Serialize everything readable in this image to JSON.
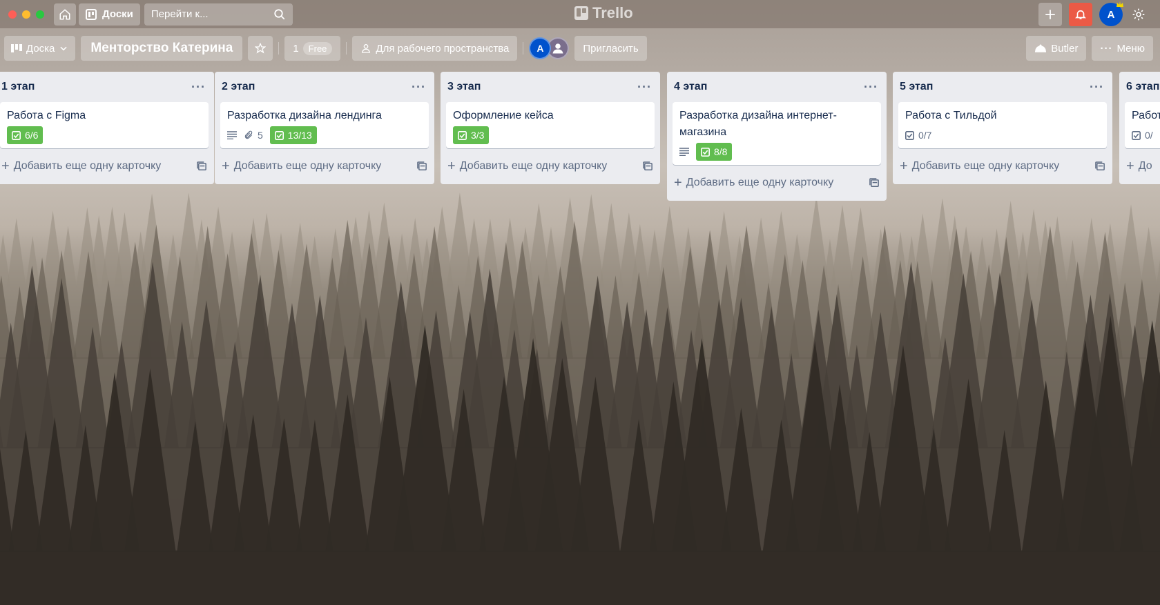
{
  "app": {
    "logo_text": "Trello",
    "boards_label": "Доски",
    "search_placeholder": "Перейти к..."
  },
  "account": {
    "avatar_initial": "A"
  },
  "board": {
    "view_label": "Доска",
    "title": "Менторство Катерина",
    "member_count": "1",
    "plan_label": "Free",
    "visibility_label": "Для рабочего пространства",
    "invite_label": "Пригласить",
    "butler_label": "Butler",
    "menu_label": "Меню",
    "members": [
      {
        "initial": "A",
        "color": "#0052cc"
      }
    ]
  },
  "lists": [
    {
      "title": "1 этап",
      "cards": [
        {
          "title": "Работа с Figma",
          "description": false,
          "attachments": "",
          "checklist": "6/6",
          "complete": true
        }
      ]
    },
    {
      "title": "2 этап",
      "cards": [
        {
          "title": "Разработка дизайна лендинга",
          "description": true,
          "attachments": "5",
          "checklist": "13/13",
          "complete": true
        }
      ]
    },
    {
      "title": "3 этап",
      "cards": [
        {
          "title": "Оформление кейса",
          "description": false,
          "attachments": "",
          "checklist": "3/3",
          "complete": true
        }
      ]
    },
    {
      "title": "4 этап",
      "cards": [
        {
          "title": "Разработка дизайна интернет-магазина",
          "description": true,
          "attachments": "",
          "checklist": "8/8",
          "complete": true
        }
      ]
    },
    {
      "title": "5 этап",
      "cards": [
        {
          "title": "Работа с Тильдой",
          "description": false,
          "attachments": "",
          "checklist": "0/7",
          "complete": false
        }
      ]
    },
    {
      "title": "6 этап",
      "cards": [
        {
          "title": "Работа",
          "description": false,
          "attachments": "",
          "checklist": "0/",
          "complete": false
        }
      ]
    }
  ],
  "add_card_label": "Добавить еще одну карточку",
  "add_card_short": "До",
  "colors": {
    "complete": "#61bd4f",
    "notification": "#eb5a46",
    "avatar": "#0052cc"
  }
}
